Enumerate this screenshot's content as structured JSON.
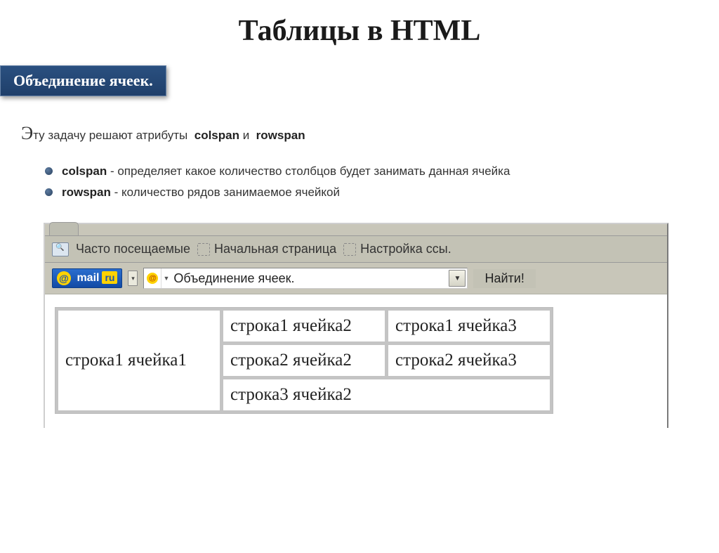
{
  "slide": {
    "title": "Таблицы в HTML",
    "subtitle": "Объединение ячеек."
  },
  "intro": {
    "prefix_cap": "Э",
    "prefix_rest": "ту задачу решают атрибуты",
    "kw1": "colspan",
    "conj": " и ",
    "kw2": "rowspan"
  },
  "bullets": [
    {
      "kw": "colspan",
      "desc": "  - определяет какое количество столбцов будет занимать данная ячейка"
    },
    {
      "kw": "rowspan",
      "desc": "  - количество рядов занимаемое ячейкой"
    }
  ],
  "browser": {
    "bookmarks": [
      "Часто посещаемые",
      "Начальная страница",
      "Настройка ссы."
    ],
    "mailru_label_mail": "mail",
    "mailru_label_ru": "ru",
    "search_value": "Объединение ячеек.",
    "find_label": "Найти!"
  },
  "table": {
    "r1c1": "строка1 ячейка1",
    "r1c2": "строка1 ячейка2",
    "r1c3": "строка1 ячейка3",
    "r2c2": "строка2 ячейка2",
    "r2c3": "строка2 ячейка3",
    "r3c2": "строка3 ячейка2"
  }
}
